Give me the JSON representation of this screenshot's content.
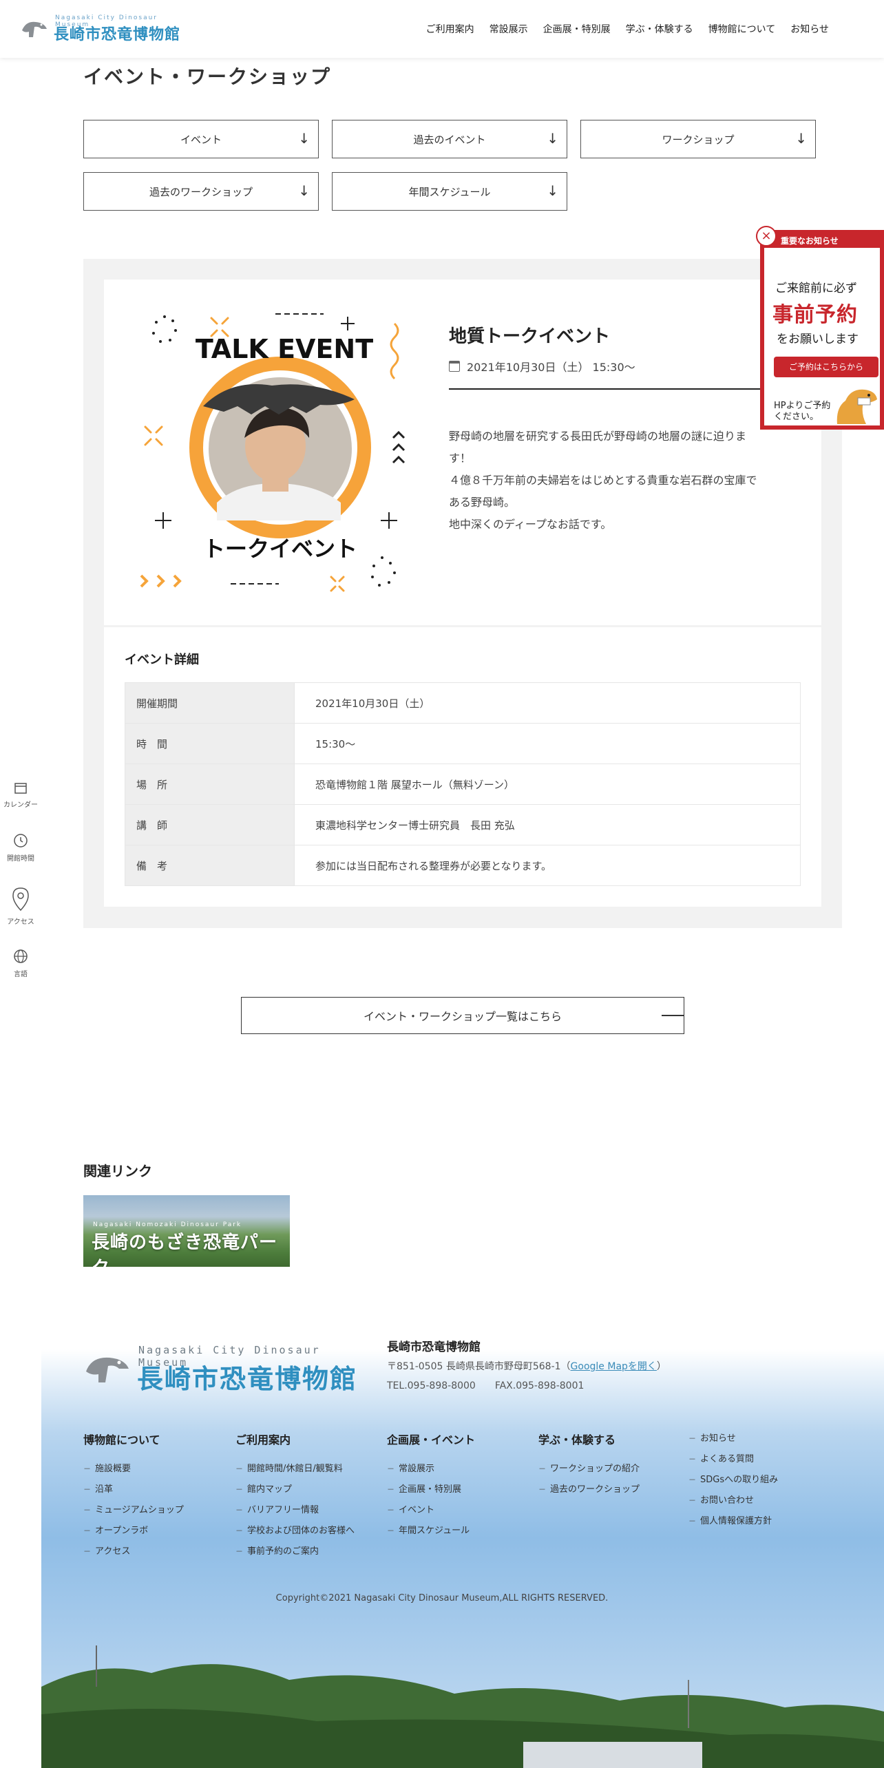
{
  "header": {
    "logo_en": "Nagasaki City Dinosaur Museum",
    "logo_ja": "長崎市恐竜博物館",
    "nav": [
      "ご利用案内",
      "常設展示",
      "企画展・特別展",
      "学ぶ・体験する",
      "博物館について",
      "お知らせ"
    ]
  },
  "page_title": "イベント・ワークショップ",
  "anchors": [
    "イベント",
    "過去のイベント",
    "ワークショップ",
    "過去のワークショップ",
    "年間スケジュール"
  ],
  "anchor_arrow": "↓",
  "event": {
    "poster_en": "TALK EVENT",
    "poster_ja": "トークイベント",
    "title": "地質トークイベント",
    "date": "2021年10月30日（土） 15:30〜",
    "desc": [
      "野母崎の地層を研究する長田氏が野母崎の地層の謎に迫りま",
      "す！",
      "４億８千万年前の夫婦岩をはじめとする貴重な岩石群の宝庫で",
      "ある野母崎。",
      "地中深くのディープなお話です。"
    ]
  },
  "details": {
    "heading": "イベント詳細",
    "rows": [
      {
        "key": "開催期間",
        "value": "2021年10月30日（土）"
      },
      {
        "key": "時　間",
        "value": "15:30〜"
      },
      {
        "key": "場　所",
        "value": "恐竜博物館１階 展望ホール（無料ゾーン）"
      },
      {
        "key": "講　師",
        "value": "東濃地科学センター博士研究員　長田 充弘"
      },
      {
        "key": "備　考",
        "value": "参加には当日配布される整理券が必要となります。"
      }
    ]
  },
  "list_button": "イベント・ワークショップ一覧はこちら",
  "related": {
    "heading": "関連リンク",
    "banner_en": "Nagasaki Nomozaki Dinosaur Park",
    "banner_ja": "長崎のもざき恐竜パーク"
  },
  "side": [
    "カレンダー",
    "開館時間",
    "アクセス",
    "言語"
  ],
  "notice": {
    "header": "重要なお知らせ",
    "line1": "ご来館前に必ず",
    "line2": "事前予約",
    "line3": "をお願いします",
    "button": "ご予約はこちらから",
    "line4": "HPよりご予約ください。",
    "close": "×"
  },
  "footer": {
    "logo_en": "Nagasaki City Dinosaur Museum",
    "logo_ja": "長崎市恐竜博物館",
    "name": "長崎市恐竜博物館",
    "address": "〒851-0505 長崎県長崎市野母町568-1（",
    "map_link": "Google Mapを開く",
    "address_end": "）",
    "tel": "TEL.095-898-8000　　FAX.095-898-8001",
    "columns": [
      {
        "heading": "博物館について",
        "items": [
          "施設概要",
          "沿革",
          "ミュージアムショップ",
          "オープンラボ",
          "アクセス"
        ]
      },
      {
        "heading": "ご利用案内",
        "items": [
          "開館時間/休館日/観覧料",
          "館内マップ",
          "バリアフリー情報",
          "学校および団体のお客様へ",
          "事前予約のご案内"
        ]
      },
      {
        "heading": "企画展・イベント",
        "items": [
          "常設展示",
          "企画展・特別展",
          "イベント",
          "年間スケジュール"
        ]
      },
      {
        "heading": "学ぶ・体験する",
        "items": [
          "ワークショップの紹介",
          "過去のワークショップ"
        ]
      },
      {
        "heading": "",
        "items": [
          "お知らせ",
          "よくある質問",
          "SDGsへの取り組み",
          "お問い合わせ",
          "個人情報保護方針"
        ]
      }
    ],
    "copyright": "Copyright©2021 Nagasaki City Dinosaur Museum,ALL RIGHTS RESERVED."
  }
}
